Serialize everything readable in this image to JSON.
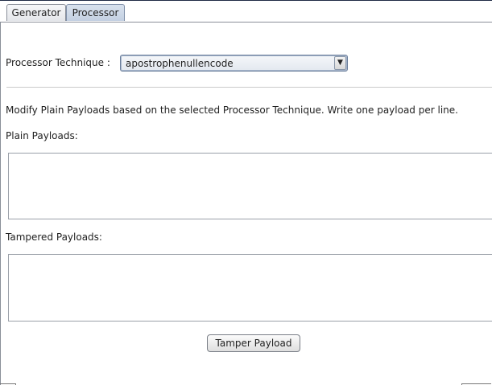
{
  "tabs": [
    {
      "label": "Generator",
      "active": false
    },
    {
      "label": "Processor",
      "active": true
    }
  ],
  "processor": {
    "technique_label": "Processor Technique :",
    "technique_selected": "apostrophenullencode",
    "dropdown_arrow": "▼"
  },
  "instructions": "Modify Plain Payloads based on the selected Processor Technique. Write one payload per line.",
  "plain_payloads": {
    "label": "Plain Payloads:",
    "value": ""
  },
  "tampered_payloads": {
    "label": "Tampered Payloads:",
    "value": ""
  },
  "actions": {
    "tamper_label": "Tamper Payload"
  },
  "colors": {
    "active_tab": "#c3d0e2",
    "border": "#8a8f99"
  }
}
